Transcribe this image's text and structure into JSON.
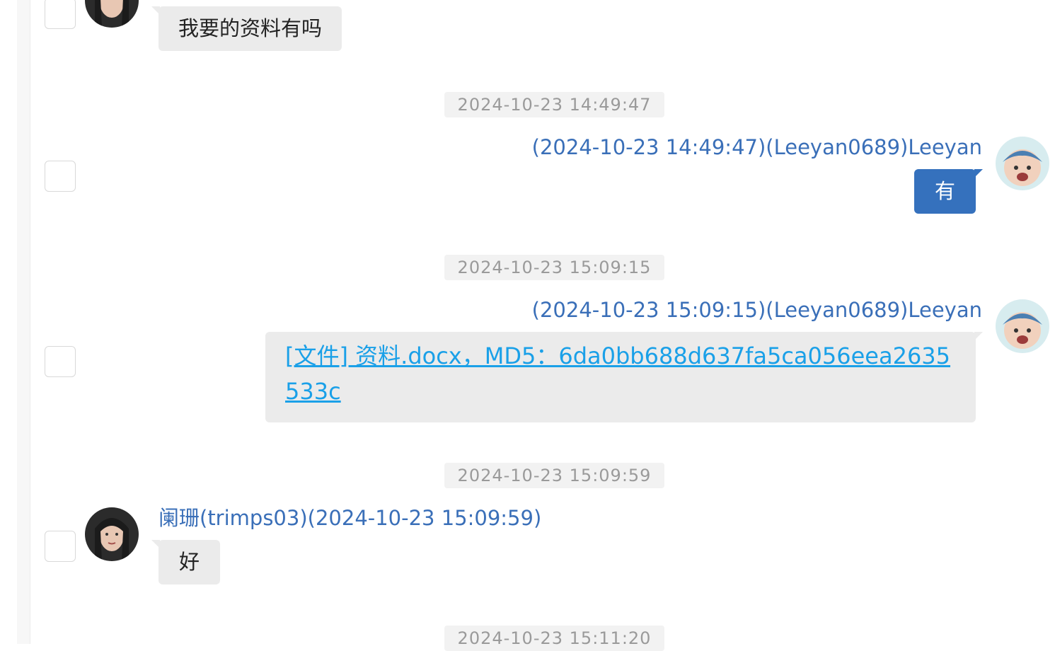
{
  "messages": [
    {
      "kind": "incoming",
      "text": "我要的资料有吗"
    },
    {
      "kind": "outgoing",
      "timestamp": "2024-10-23 14:49:47",
      "sender": "(2024-10-23 14:49:47)(Leeyan0689)Leeyan",
      "text": "有"
    },
    {
      "kind": "outgoing-file",
      "timestamp": "2024-10-23 15:09:15",
      "sender": "(2024-10-23 15:09:15)(Leeyan0689)Leeyan",
      "text": "[文件] 资料.docx，MD5：6da0bb688d637fa5ca056eea2635533c"
    },
    {
      "kind": "incoming",
      "timestamp": "2024-10-23 15:09:59",
      "sender": "阑珊(trimps03)(2024-10-23 15:09:59)",
      "text": "好"
    },
    {
      "timestamp": "2024-10-23 15:11:20"
    }
  ],
  "icons": {
    "checkbox": "checkbox-icon",
    "avatar_contact": "avatar-woman",
    "avatar_self": "avatar-baby"
  },
  "colors": {
    "sender_name": "#3a6fb8",
    "outgoing_bubble": "#3571bd",
    "incoming_bubble": "#ebebeb",
    "file_link": "#1aa0e8",
    "timestamp_text": "#9a9a9a"
  }
}
